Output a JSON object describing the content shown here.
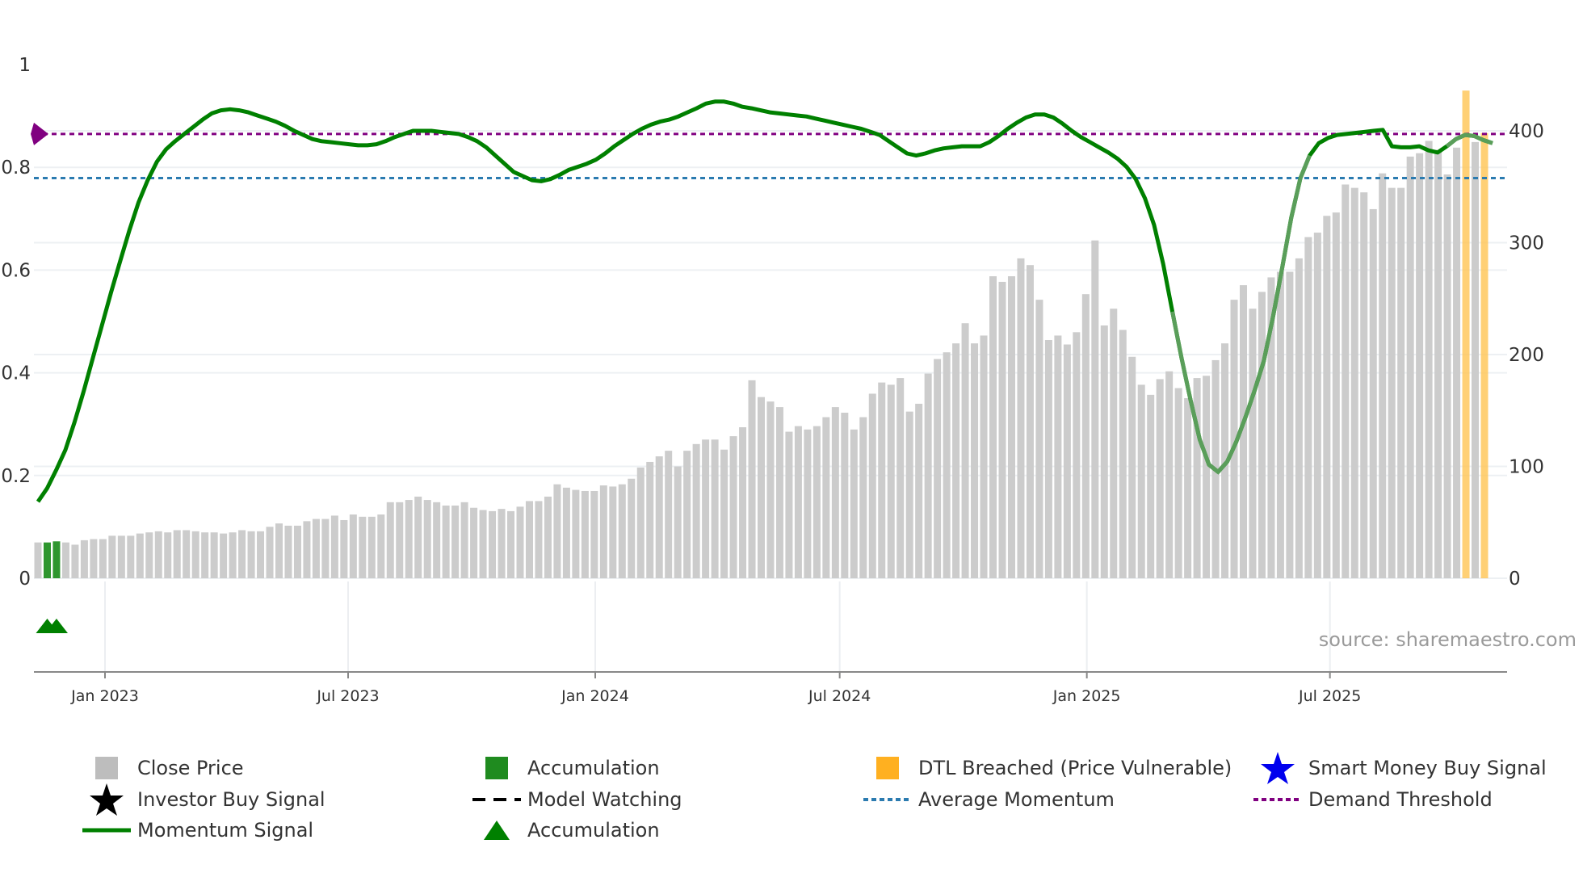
{
  "chart_data": {
    "type": "bar+line",
    "title": "",
    "source": "source: sharemaestro.com",
    "left_axis": {
      "ticks": [
        "0",
        "0.2",
        "0.4",
        "0.6",
        "0.8",
        "1"
      ],
      "tick_values": [
        0,
        0.2,
        0.4,
        0.6,
        0.8,
        1
      ],
      "range": [
        0,
        1
      ]
    },
    "right_axis": {
      "ticks": [
        "0",
        "100",
        "200",
        "300",
        "400"
      ],
      "tick_values": [
        0,
        100,
        200,
        300,
        400
      ],
      "range": [
        0,
        459
      ]
    },
    "x_ticks": [
      {
        "label": "Jan 2023",
        "date": "2023-01-01"
      },
      {
        "label": "Jul 2023",
        "date": "2023-07-01"
      },
      {
        "label": "Jan 2024",
        "date": "2024-01-01"
      },
      {
        "label": "Jul 2024",
        "date": "2024-07-01"
      },
      {
        "label": "Jan 2025",
        "date": "2025-01-01"
      },
      {
        "label": "Jul 2025",
        "date": "2025-07-01"
      }
    ],
    "bar_frequency": "weekly",
    "close_price": [
      32,
      32,
      33,
      32,
      30,
      34,
      35,
      35,
      38,
      38,
      38,
      40,
      41,
      42,
      41,
      43,
      43,
      42,
      41,
      41,
      40,
      41,
      43,
      42,
      42,
      46,
      49,
      47,
      47,
      51,
      53,
      53,
      56,
      52,
      57,
      55,
      55,
      57,
      68,
      68,
      70,
      73,
      70,
      68,
      65,
      65,
      68,
      63,
      61,
      60,
      62,
      60,
      64,
      69,
      69,
      73,
      84,
      81,
      79,
      78,
      78,
      83,
      82,
      84,
      89,
      99,
      104,
      109,
      114,
      100,
      114,
      120,
      124,
      124,
      115,
      127,
      135,
      177,
      162,
      158,
      153,
      131,
      136,
      133,
      136,
      144,
      153,
      148,
      133,
      144,
      165,
      175,
      173,
      179,
      149,
      156,
      183,
      196,
      202,
      210,
      228,
      210,
      217,
      270,
      265,
      270,
      286,
      280,
      249,
      213,
      217,
      209,
      220,
      254,
      302,
      226,
      241,
      222,
      198,
      173,
      164,
      178,
      185,
      170,
      161,
      179,
      181,
      195,
      210,
      249,
      262,
      241,
      256,
      269,
      274,
      274,
      286,
      305,
      309,
      324,
      327,
      352,
      349,
      345,
      330,
      362,
      349,
      349,
      377,
      380,
      391,
      383,
      361,
      385,
      436,
      390,
      398
    ],
    "accumulation_bar_indices": [
      1,
      2
    ],
    "dtl_breached_bar_indices": [
      154,
      156
    ],
    "momentum_signal": [
      0.149,
      0.175,
      0.211,
      0.25,
      0.304,
      0.364,
      0.429,
      0.493,
      0.557,
      0.618,
      0.678,
      0.732,
      0.775,
      0.811,
      0.835,
      0.851,
      0.865,
      0.879,
      0.893,
      0.905,
      0.911,
      0.913,
      0.911,
      0.907,
      0.901,
      0.895,
      0.889,
      0.881,
      0.871,
      0.863,
      0.855,
      0.851,
      0.849,
      0.847,
      0.845,
      0.843,
      0.843,
      0.845,
      0.851,
      0.859,
      0.865,
      0.871,
      0.871,
      0.871,
      0.869,
      0.867,
      0.865,
      0.859,
      0.851,
      0.839,
      0.823,
      0.807,
      0.791,
      0.783,
      0.775,
      0.773,
      0.777,
      0.785,
      0.795,
      0.801,
      0.807,
      0.815,
      0.827,
      0.841,
      0.853,
      0.865,
      0.875,
      0.883,
      0.889,
      0.893,
      0.899,
      0.907,
      0.915,
      0.924,
      0.928,
      0.928,
      0.924,
      0.918,
      0.915,
      0.911,
      0.907,
      0.905,
      0.903,
      0.901,
      0.899,
      0.895,
      0.891,
      0.887,
      0.883,
      0.879,
      0.875,
      0.869,
      0.863,
      0.851,
      0.839,
      0.827,
      0.823,
      0.827,
      0.833,
      0.837,
      0.839,
      0.841,
      0.841,
      0.841,
      0.849,
      0.861,
      0.875,
      0.887,
      0.897,
      0.903,
      0.903,
      0.897,
      0.885,
      0.871,
      0.859,
      0.849,
      0.839,
      0.829,
      0.817,
      0.801,
      0.777,
      0.74,
      0.688,
      0.612,
      0.519,
      0.429,
      0.346,
      0.27,
      0.221,
      0.207,
      0.227,
      0.266,
      0.314,
      0.366,
      0.423,
      0.509,
      0.604,
      0.702,
      0.779,
      0.823,
      0.847,
      0.857,
      0.863,
      0.865,
      0.867,
      0.869,
      0.871,
      0.873,
      0.841,
      0.839,
      0.839,
      0.841,
      0.833,
      0.829,
      0.841,
      0.855,
      0.863,
      0.861,
      0.853,
      0.847
    ],
    "model_watching_ranges": [
      [
        124,
        139
      ],
      [
        154,
        159
      ]
    ],
    "average_momentum": 0.779,
    "demand_threshold": 0.865,
    "accumulation_markers": [
      1,
      2
    ],
    "legend_placement": "bottom",
    "legend": [
      {
        "label": "Close Price",
        "icon": "gray-square-icon",
        "color": "#bdbdbd"
      },
      {
        "label": "Accumulation",
        "icon": "green-square-icon",
        "color": "#1f8b1f"
      },
      {
        "label": "DTL Breached (Price Vulnerable)",
        "icon": "orange-square-icon",
        "color": "#ffb020"
      },
      {
        "label": "Smart Money Buy Signal",
        "icon": "blue-star-icon",
        "color": "#0000ee"
      },
      {
        "label": "Investor Buy Signal",
        "icon": "black-star-icon",
        "color": "#000000"
      },
      {
        "label": "Model Watching",
        "icon": "dashed-line-icon",
        "color": "#000000"
      },
      {
        "label": "Average Momentum",
        "icon": "blue-dotted-line-icon",
        "color": "#2b7bb0"
      },
      {
        "label": "Demand Threshold",
        "icon": "purple-dotted-line-icon",
        "color": "#800080"
      },
      {
        "label": "Momentum Signal",
        "icon": "green-line-icon",
        "color": "#008000"
      },
      {
        "label": "Accumulation",
        "icon": "green-triangle-icon",
        "color": "#008000"
      }
    ]
  }
}
